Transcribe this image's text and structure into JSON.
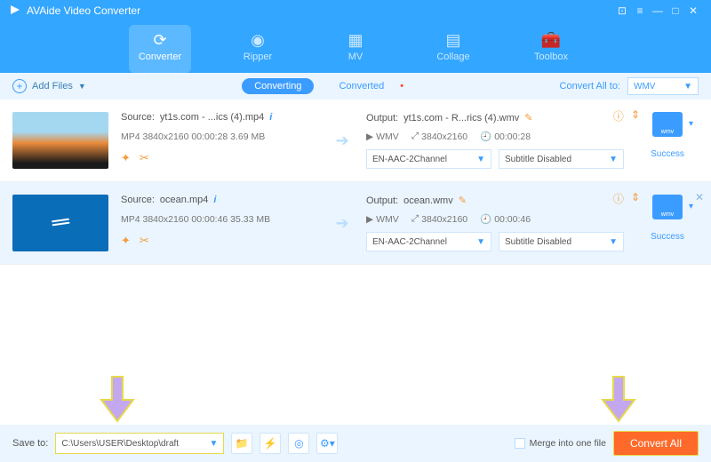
{
  "title": "AVAide Video Converter",
  "nav": {
    "converter": "Converter",
    "ripper": "Ripper",
    "mv": "MV",
    "collage": "Collage",
    "toolbox": "Toolbox"
  },
  "subbar": {
    "add": "Add Files",
    "converting": "Converting",
    "converted": "Converted",
    "convall": "Convert All to:",
    "fmt": "WMV"
  },
  "items": [
    {
      "src_label": "Source:",
      "src_name": "yt1s.com - ...ics (4).mp4",
      "src_meta": "MP4   3840x2160   00:00:28   3.69 MB",
      "out_label": "Output:",
      "out_name": "yt1s.com - R...rics (4).wmv",
      "out_fmt": "WMV",
      "out_res": "3840x2160",
      "out_dur": "00:00:28",
      "audio": "EN-AAC-2Channel",
      "sub": "Subtitle Disabled",
      "badge": "wmv",
      "status": "Success"
    },
    {
      "src_label": "Source:",
      "src_name": "ocean.mp4",
      "src_meta": "MP4   3840x2160   00:00:46   35.33 MB",
      "out_label": "Output:",
      "out_name": "ocean.wmv",
      "out_fmt": "WMV",
      "out_res": "3840x2160",
      "out_dur": "00:00:46",
      "audio": "EN-AAC-2Channel",
      "sub": "Subtitle Disabled",
      "badge": "wmv",
      "status": "Success"
    }
  ],
  "bottom": {
    "saveto": "Save to:",
    "path": "C:\\Users\\USER\\Desktop\\draft",
    "merge": "Merge into one file",
    "convert": "Convert All"
  }
}
